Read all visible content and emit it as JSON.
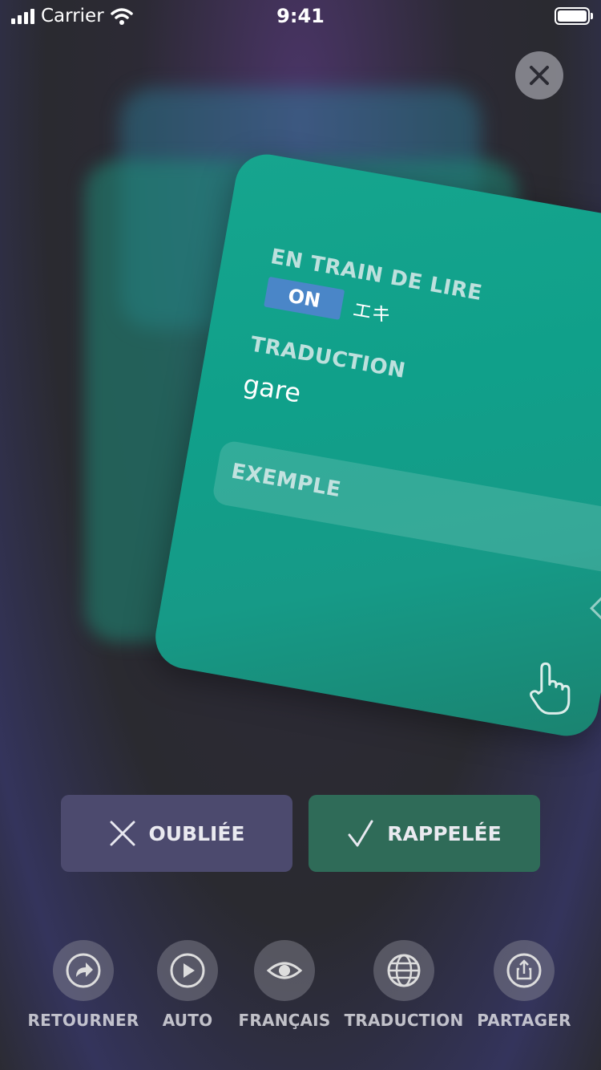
{
  "status_bar": {
    "carrier": "Carrier",
    "time": "9:41"
  },
  "card": {
    "reading_label": "EN TRAIN DE LIRE",
    "reading_badge": "ON",
    "reading_kana": "エキ",
    "translation_label": "TRADUCTION",
    "translation_value": "gare",
    "example_label": "EXEMPLE"
  },
  "actions": {
    "forget_label": "OUBLIÉE",
    "remember_label": "RAPPELÉE"
  },
  "toolbar": [
    {
      "label": "RETOURNER",
      "icon": "flip-icon"
    },
    {
      "label": "AUTO",
      "icon": "play-icon"
    },
    {
      "label": "FRANÇAIS",
      "icon": "eye-icon"
    },
    {
      "label": "TRADUCTION",
      "icon": "globe-icon"
    },
    {
      "label": "PARTAGER",
      "icon": "share-icon"
    }
  ],
  "colors": {
    "card": "#10a08a",
    "forget_button": "#4c4a6e",
    "remember_button": "#2f6b58",
    "on_badge": "#4a86c8"
  }
}
